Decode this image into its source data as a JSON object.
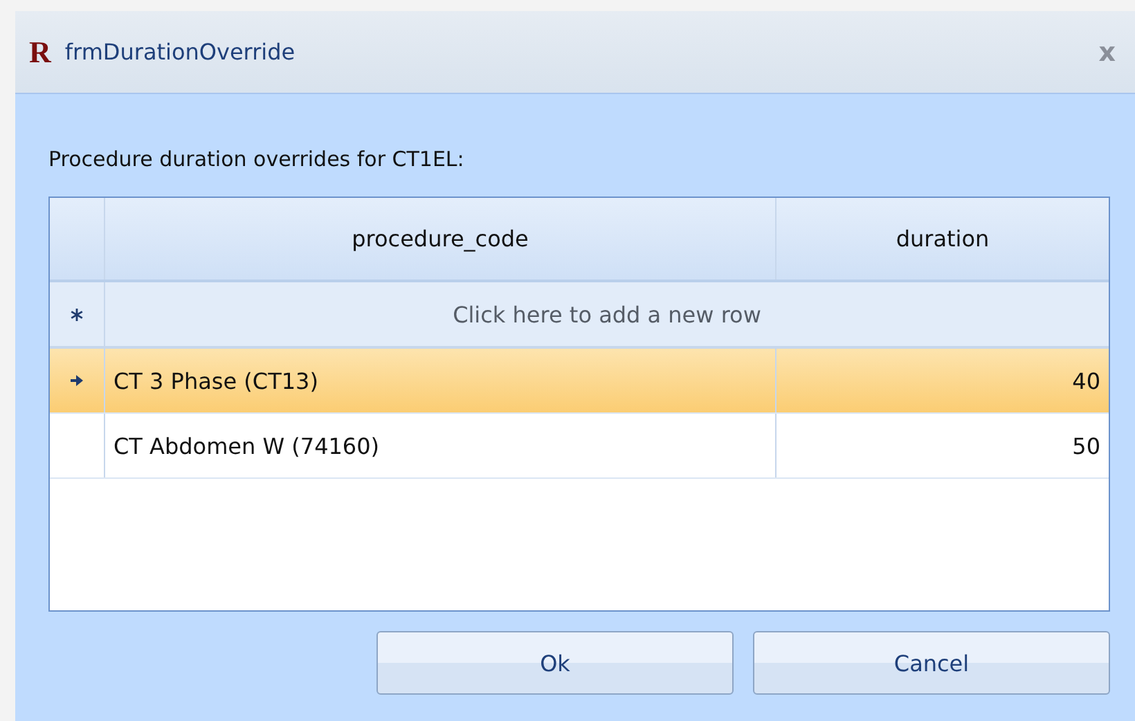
{
  "window": {
    "logo": "R",
    "title": "frmDurationOverride",
    "close": "x"
  },
  "prompt": "Procedure duration overrides for CT1EL:",
  "table": {
    "columns": [
      "procedure_code",
      "duration"
    ],
    "new_row": "Click here to add a new row",
    "rows": [
      {
        "procedure_code": "CT 3 Phase (CT13)",
        "duration": "40",
        "selected": true
      },
      {
        "procedure_code": "CT Abdomen W (74160)",
        "duration": "50",
        "selected": false
      }
    ]
  },
  "buttons": [
    "Ok",
    "Cancel"
  ]
}
